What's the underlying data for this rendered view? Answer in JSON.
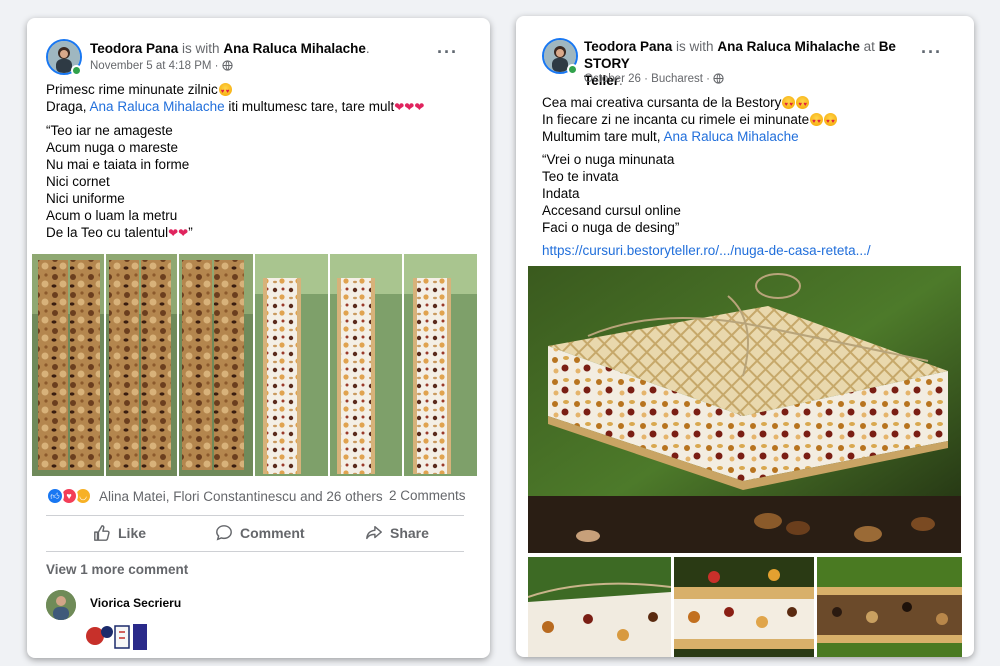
{
  "left_post": {
    "author": "Teodora Pana",
    "with_text": "is with",
    "tagged": "Ana Raluca Mihalache",
    "period": ".",
    "timestamp": "November 5 at 4:18 PM",
    "separator": "·",
    "privacy_icon": "globe-icon",
    "more_icon": "more-options-icon",
    "lines": {
      "l1": "Primesc rime minunate zilnic",
      "l2_prefix": "Draga,",
      "l2_link": "Ana Raluca Mihalache",
      "l2_suffix": "iti multumesc tare, tare mult",
      "l3": "“Teo iar ne amageste",
      "l4": "Acum nuga o mareste",
      "l5": "Nu mai e taiata in forme",
      "l6": "Nici cornet",
      "l7": "Nici uniforme",
      "l8": "Acum o luam la metru",
      "l9": "De la Teo cu talentul",
      "l9_end": "”"
    },
    "reactions_names": "Alina Matei, Flori Constantinescu and 26 others",
    "comments_count": "2 Comments",
    "like_label": "Like",
    "comment_label": "Comment",
    "share_label": "Share",
    "view_more": "View 1 more comment",
    "commenter": "Viorica Secrieru"
  },
  "right_post": {
    "author": "Teodora Pana",
    "with_text": "is with",
    "tagged": "Ana Raluca Mihalache",
    "at_text": "at",
    "place": "Be STORY",
    "place2": "Teller",
    "period": ".",
    "timestamp": "October 26",
    "separator": "·",
    "location": "Bucharest",
    "privacy_icon": "globe-icon",
    "more_icon": "more-options-icon",
    "lines": {
      "l1": "Cea mai creativa cursanta de la Bestory",
      "l2": "In fiecare zi ne incanta cu rimele ei minunate",
      "l3_prefix": "Multumim tare mult,",
      "l3_link": "Ana Raluca Mihalache",
      "l4": "“Vrei o nuga minunata",
      "l5": "Teo te invata",
      "l6": "Indata",
      "l7": "Accesand cursul online",
      "l8": "Faci o nuga de desing”",
      "url": "https://cursuri.bestoryteller.ro/.../nuga-de-casa-reteta.../"
    }
  },
  "colors": {
    "link": "#216fdb",
    "like_blue": "#1877f2",
    "love_red": "#f33e58",
    "haha_yellow": "#f7b125",
    "online_green": "#31a24c"
  }
}
